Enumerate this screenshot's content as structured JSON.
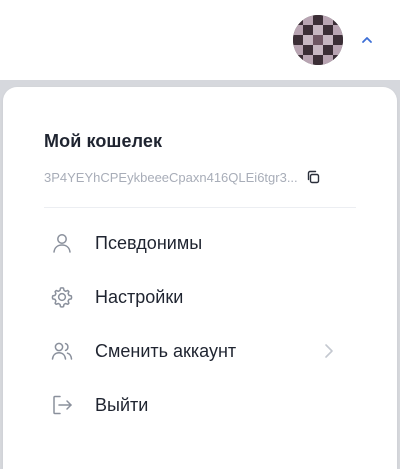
{
  "header": {
    "avatar_icon": "identicon-avatar",
    "menu_toggle_icon": "chevron-up-icon",
    "accent_color": "#3d6fd6"
  },
  "panel": {
    "title": "Мой кошелек",
    "address": "3P4YEYhCPEykbeeeCpaxn416QLEi6tgr3...",
    "copy_icon": "copy-icon"
  },
  "menu": {
    "items": [
      {
        "label": "Псевдонимы",
        "icon": "user-icon"
      },
      {
        "label": "Настройки",
        "icon": "gear-icon"
      },
      {
        "label": "Сменить аккаунт",
        "icon": "users-icon",
        "has_submenu": true
      },
      {
        "label": "Выйти",
        "icon": "logout-icon"
      }
    ]
  },
  "colors": {
    "text_primary": "#1f2430",
    "text_muted": "#a8adb8",
    "icon_gray": "#8a909c",
    "overlay": "#d6d8dd"
  }
}
